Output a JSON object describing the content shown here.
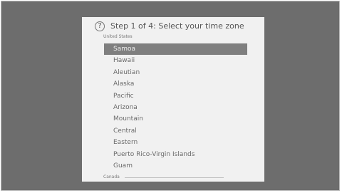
{
  "dialog": {
    "help_icon_glyph": "?",
    "title": "Step 1 of 4: Select your time zone",
    "sections": [
      {
        "label": "United States"
      },
      {
        "label": "Canada"
      }
    ],
    "time_zones": [
      {
        "label": "Samoa",
        "selected": true
      },
      {
        "label": "Hawaii",
        "selected": false
      },
      {
        "label": "Aleutian",
        "selected": false
      },
      {
        "label": "Alaska",
        "selected": false
      },
      {
        "label": "Pacific",
        "selected": false
      },
      {
        "label": "Arizona",
        "selected": false
      },
      {
        "label": "Mountain",
        "selected": false
      },
      {
        "label": "Central",
        "selected": false
      },
      {
        "label": "Eastern",
        "selected": false
      },
      {
        "label": "Puerto Rico-Virgin Islands",
        "selected": false
      },
      {
        "label": "Guam",
        "selected": false
      }
    ]
  },
  "colors": {
    "background": "#6d6d6d",
    "dialog": "#f1f1f1",
    "highlight": "#7f7f7f"
  }
}
